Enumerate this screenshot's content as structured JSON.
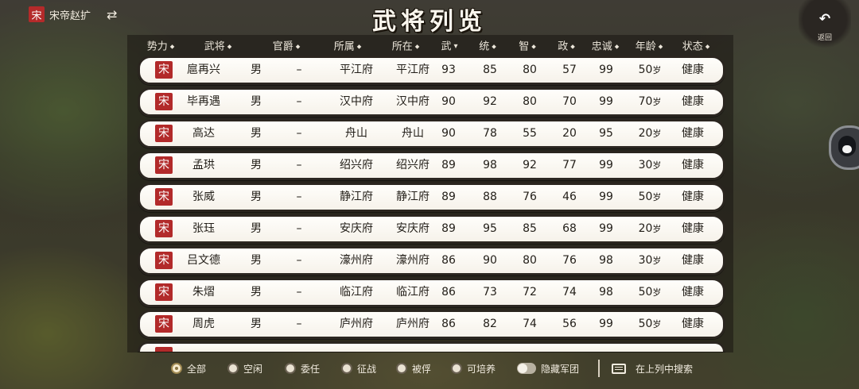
{
  "top_left": {
    "seal": "宋",
    "faction": "宋帝赵扩",
    "swap_icon": "swap-arrows-icon"
  },
  "title": "武将列览",
  "back": {
    "icon": "undo-arrow-icon",
    "label": "返回"
  },
  "side_button": {
    "icon": "penguin-icon"
  },
  "columns": [
    {
      "key": "faction",
      "label": "势力",
      "sortable": true
    },
    {
      "key": "name",
      "label": "武将",
      "sortable": true
    },
    {
      "key": "rank",
      "label": "官爵",
      "sortable": true
    },
    {
      "key": "belongs",
      "label": "所属",
      "sortable": true
    },
    {
      "key": "location",
      "label": "所在",
      "sortable": true
    },
    {
      "key": "war",
      "label": "武",
      "sortable": true,
      "sorted": true
    },
    {
      "key": "lead",
      "label": "统",
      "sortable": true
    },
    {
      "key": "intel",
      "label": "智",
      "sortable": true
    },
    {
      "key": "pol",
      "label": "政",
      "sortable": true
    },
    {
      "key": "loyalty",
      "label": "忠诚",
      "sortable": true
    },
    {
      "key": "age",
      "label": "年龄",
      "sortable": true
    },
    {
      "key": "status",
      "label": "状态",
      "sortable": true
    }
  ],
  "age_unit": "岁",
  "rows": [
    {
      "seal": "宋",
      "name": "扈再兴",
      "gender": "男",
      "rank": "–",
      "belongs": "平江府",
      "location": "平江府",
      "war": "93",
      "lead": "85",
      "intel": "80",
      "pol": "57",
      "loyalty": "99",
      "age": "50",
      "status": "健康"
    },
    {
      "seal": "宋",
      "name": "毕再遇",
      "gender": "男",
      "rank": "–",
      "belongs": "汉中府",
      "location": "汉中府",
      "war": "90",
      "lead": "92",
      "intel": "80",
      "pol": "70",
      "loyalty": "99",
      "age": "70",
      "status": "健康"
    },
    {
      "seal": "宋",
      "name": "高达",
      "gender": "男",
      "rank": "–",
      "belongs": "舟山",
      "location": "舟山",
      "war": "90",
      "lead": "78",
      "intel": "55",
      "pol": "20",
      "loyalty": "95",
      "age": "20",
      "status": "健康"
    },
    {
      "seal": "宋",
      "name": "孟珙",
      "gender": "男",
      "rank": "–",
      "belongs": "绍兴府",
      "location": "绍兴府",
      "war": "89",
      "lead": "98",
      "intel": "92",
      "pol": "77",
      "loyalty": "99",
      "age": "30",
      "status": "健康"
    },
    {
      "seal": "宋",
      "name": "张威",
      "gender": "男",
      "rank": "–",
      "belongs": "静江府",
      "location": "静江府",
      "war": "89",
      "lead": "88",
      "intel": "76",
      "pol": "46",
      "loyalty": "99",
      "age": "50",
      "status": "健康"
    },
    {
      "seal": "宋",
      "name": "张珏",
      "gender": "男",
      "rank": "–",
      "belongs": "安庆府",
      "location": "安庆府",
      "war": "89",
      "lead": "95",
      "intel": "85",
      "pol": "68",
      "loyalty": "99",
      "age": "20",
      "status": "健康"
    },
    {
      "seal": "宋",
      "name": "吕文德",
      "gender": "男",
      "rank": "–",
      "belongs": "濠州府",
      "location": "濠州府",
      "war": "86",
      "lead": "90",
      "intel": "80",
      "pol": "76",
      "loyalty": "98",
      "age": "30",
      "status": "健康"
    },
    {
      "seal": "宋",
      "name": "朱熠",
      "gender": "男",
      "rank": "–",
      "belongs": "临江府",
      "location": "临江府",
      "war": "86",
      "lead": "73",
      "intel": "72",
      "pol": "74",
      "loyalty": "98",
      "age": "50",
      "status": "健康"
    },
    {
      "seal": "宋",
      "name": "周虎",
      "gender": "男",
      "rank": "–",
      "belongs": "庐州府",
      "location": "庐州府",
      "war": "86",
      "lead": "82",
      "intel": "74",
      "pol": "56",
      "loyalty": "99",
      "age": "50",
      "status": "健康"
    }
  ],
  "filters": [
    {
      "label": "全部",
      "selected": true
    },
    {
      "label": "空闲",
      "selected": false
    },
    {
      "label": "委任",
      "selected": false
    },
    {
      "label": "征战",
      "selected": false
    },
    {
      "label": "被俘",
      "selected": false
    },
    {
      "label": "可培养",
      "selected": false
    }
  ],
  "hide_army_toggle": {
    "label": "隐藏军团",
    "on": false
  },
  "search": {
    "icon": "keyboard-icon",
    "label": "在上列中搜索"
  }
}
